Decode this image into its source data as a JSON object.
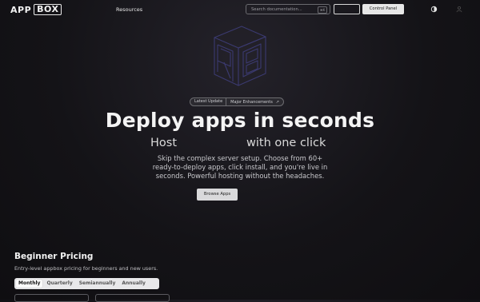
{
  "header": {
    "logo_left": "APP",
    "logo_box": "BOX",
    "nav_resources": "Resources",
    "search_placeholder": "Search documentation...",
    "search_shortcut": "⌘K",
    "control_panel_label": "Control Panel"
  },
  "hero": {
    "badge_left": "Latest Update",
    "badge_right": "Major Enhancements",
    "badge_arrow": "↗",
    "title": "Deploy apps in seconds",
    "sub_left": "Host",
    "sub_right": "with one click",
    "description": "Skip the complex server setup. Choose from 60+ ready-to-deploy apps, click install, and you're live in seconds. Powerful hosting without the headaches.",
    "browse_label": "Browse Apps"
  },
  "pricing": {
    "title": "Beginner Pricing",
    "subtitle": "Entry-level appbox pricing for beginners and new users.",
    "tabs": [
      "Monthly",
      "Quarterly",
      "Semiannually",
      "Annually"
    ],
    "active_tab": "Monthly"
  },
  "colors": {
    "background": "#141317",
    "cube_stroke": "#3b3a70",
    "button_light": "#e7e7e7"
  }
}
